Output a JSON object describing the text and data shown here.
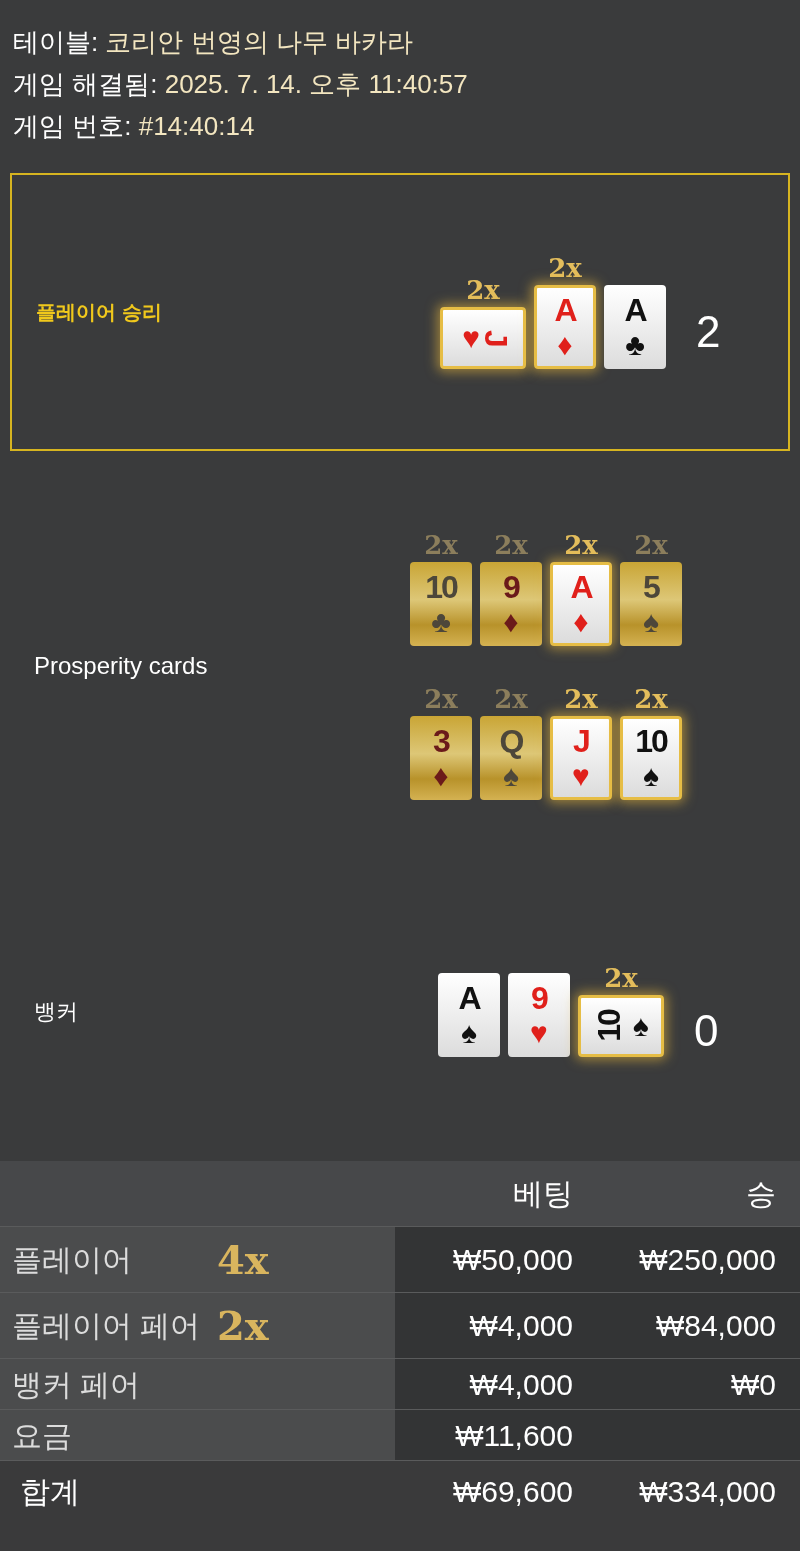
{
  "info": [
    {
      "label": "테이블:",
      "value": "코리안 번영의 나무 바카라"
    },
    {
      "label": "게임 해결됨:",
      "value": "2025. 7. 14. 오후 11:40:57"
    },
    {
      "label": "게임 번호:",
      "value": "#14:40:14"
    }
  ],
  "player": {
    "label": "플레이어 승리",
    "winner": true,
    "score": "2",
    "cards": [
      {
        "rank": "J",
        "suit": "♥",
        "red": true,
        "gold": false,
        "kind": "sideways_cw",
        "highlighted": true,
        "multiplier": "2x",
        "multiplier_lit": true
      },
      {
        "rank": "A",
        "suit": "♦",
        "red": true,
        "gold": false,
        "kind": "upright",
        "highlighted": true,
        "multiplier": "2x",
        "multiplier_lit": true
      },
      {
        "rank": "A",
        "suit": "♣",
        "red": false,
        "gold": false,
        "kind": "upright",
        "highlighted": false
      }
    ]
  },
  "prosperity": {
    "label": "Prosperity cards",
    "rows": [
      [
        {
          "rank": "10",
          "suit": "♣",
          "red": false,
          "gold": true,
          "kind": "upright",
          "highlighted": false,
          "multiplier": "2x",
          "multiplier_lit": false
        },
        {
          "rank": "9",
          "suit": "♦",
          "red": true,
          "gold": true,
          "kind": "upright",
          "highlighted": false,
          "multiplier": "2x",
          "multiplier_lit": false
        },
        {
          "rank": "A",
          "suit": "♦",
          "red": true,
          "gold": false,
          "kind": "upright",
          "highlighted": true,
          "multiplier": "2x",
          "multiplier_lit": true
        },
        {
          "rank": "5",
          "suit": "♠",
          "red": false,
          "gold": true,
          "kind": "upright",
          "highlighted": false,
          "multiplier": "2x",
          "multiplier_lit": false
        }
      ],
      [
        {
          "rank": "3",
          "suit": "♦",
          "red": true,
          "gold": true,
          "kind": "upright",
          "highlighted": false,
          "multiplier": "2x",
          "multiplier_lit": false
        },
        {
          "rank": "Q",
          "suit": "♠",
          "red": false,
          "gold": true,
          "kind": "upright",
          "highlighted": false,
          "multiplier": "2x",
          "multiplier_lit": false
        },
        {
          "rank": "J",
          "suit": "♥",
          "red": true,
          "gold": false,
          "kind": "upright",
          "highlighted": true,
          "multiplier": "2x",
          "multiplier_lit": true
        },
        {
          "rank": "10",
          "suit": "♠",
          "red": false,
          "gold": false,
          "kind": "upright",
          "highlighted": true,
          "multiplier": "2x",
          "multiplier_lit": true
        }
      ]
    ]
  },
  "banker": {
    "label": "뱅커",
    "winner": false,
    "score": "0",
    "cards": [
      {
        "rank": "A",
        "suit": "♠",
        "red": false,
        "gold": false,
        "kind": "upright",
        "highlighted": false
      },
      {
        "rank": "9",
        "suit": "♥",
        "red": true,
        "gold": false,
        "kind": "upright",
        "highlighted": false
      },
      {
        "rank": "10",
        "suit": "♠",
        "red": false,
        "gold": false,
        "kind": "sideways_ccw",
        "highlighted": true,
        "multiplier": "2x",
        "multiplier_lit": true
      }
    ]
  },
  "table": {
    "columns": [
      "베팅",
      "승"
    ],
    "rows": [
      {
        "label": "플레이어",
        "multiplier": "4x",
        "bet": "₩50,000",
        "win": "₩250,000"
      },
      {
        "label": "플레이어 페어",
        "multiplier": "2x",
        "bet": "₩4,000",
        "win": "₩84,000"
      },
      {
        "label": "뱅커 페어",
        "bet": "₩4,000",
        "win": "₩0"
      },
      {
        "label": "요금",
        "bet": "₩11,600"
      }
    ],
    "total": {
      "label": "합계",
      "bet": "₩69,600",
      "win": "₩334,000"
    }
  }
}
